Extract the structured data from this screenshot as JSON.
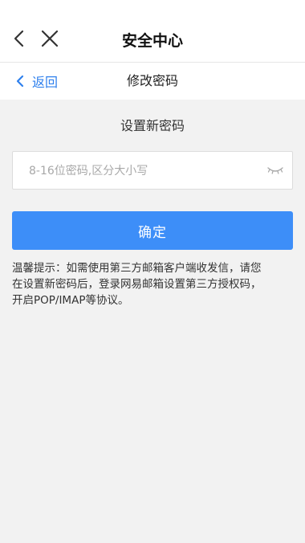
{
  "appbar": {
    "title": "安全中心",
    "back_icon": "chevron-left-icon",
    "close_icon": "close-icon"
  },
  "subbar": {
    "return_label": "返回",
    "return_icon": "chevron-left-icon",
    "title": "修改密码"
  },
  "form": {
    "section_title": "设置新密码",
    "password_placeholder": "8-16位密码,区分大小写",
    "password_value": "",
    "visibility_icon": "eye-closed-icon",
    "confirm_label": "确定"
  },
  "tip": {
    "text": "温馨提示：如需使用第三方邮箱客户端收发信，请您\n在设置新密码后，登录网易邮箱设置第三方授权码，\n开启POP/IMAP等协议。"
  },
  "colors": {
    "accent": "#3d8ef8",
    "link": "#2f80ed",
    "background": "#f2f2f2"
  }
}
